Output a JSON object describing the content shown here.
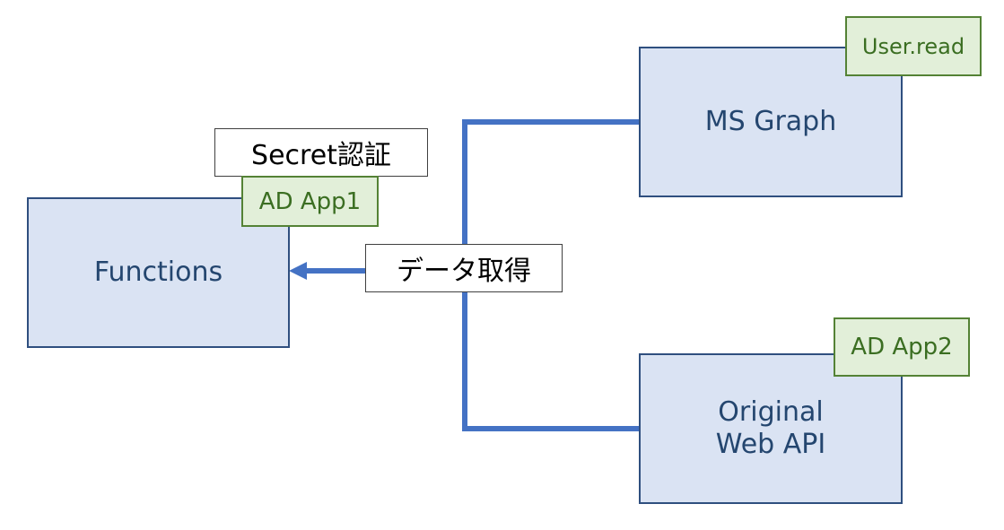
{
  "nodes": {
    "functions": {
      "label": "Functions"
    },
    "ms_graph": {
      "label": "MS Graph"
    },
    "web_api": {
      "line1": "Original",
      "line2": "Web API"
    }
  },
  "tags": {
    "user_read": "User.read",
    "ad_app1": "AD App1",
    "ad_app2": "AD App2"
  },
  "labels": {
    "secret_auth": "Secret認証",
    "data_fetch": "データ取得"
  },
  "colors": {
    "node_fill": "#dae3f3",
    "node_border": "#2f4f7f",
    "tag_fill": "#e2efd9",
    "tag_border": "#548235",
    "connector": "#4472c4"
  }
}
